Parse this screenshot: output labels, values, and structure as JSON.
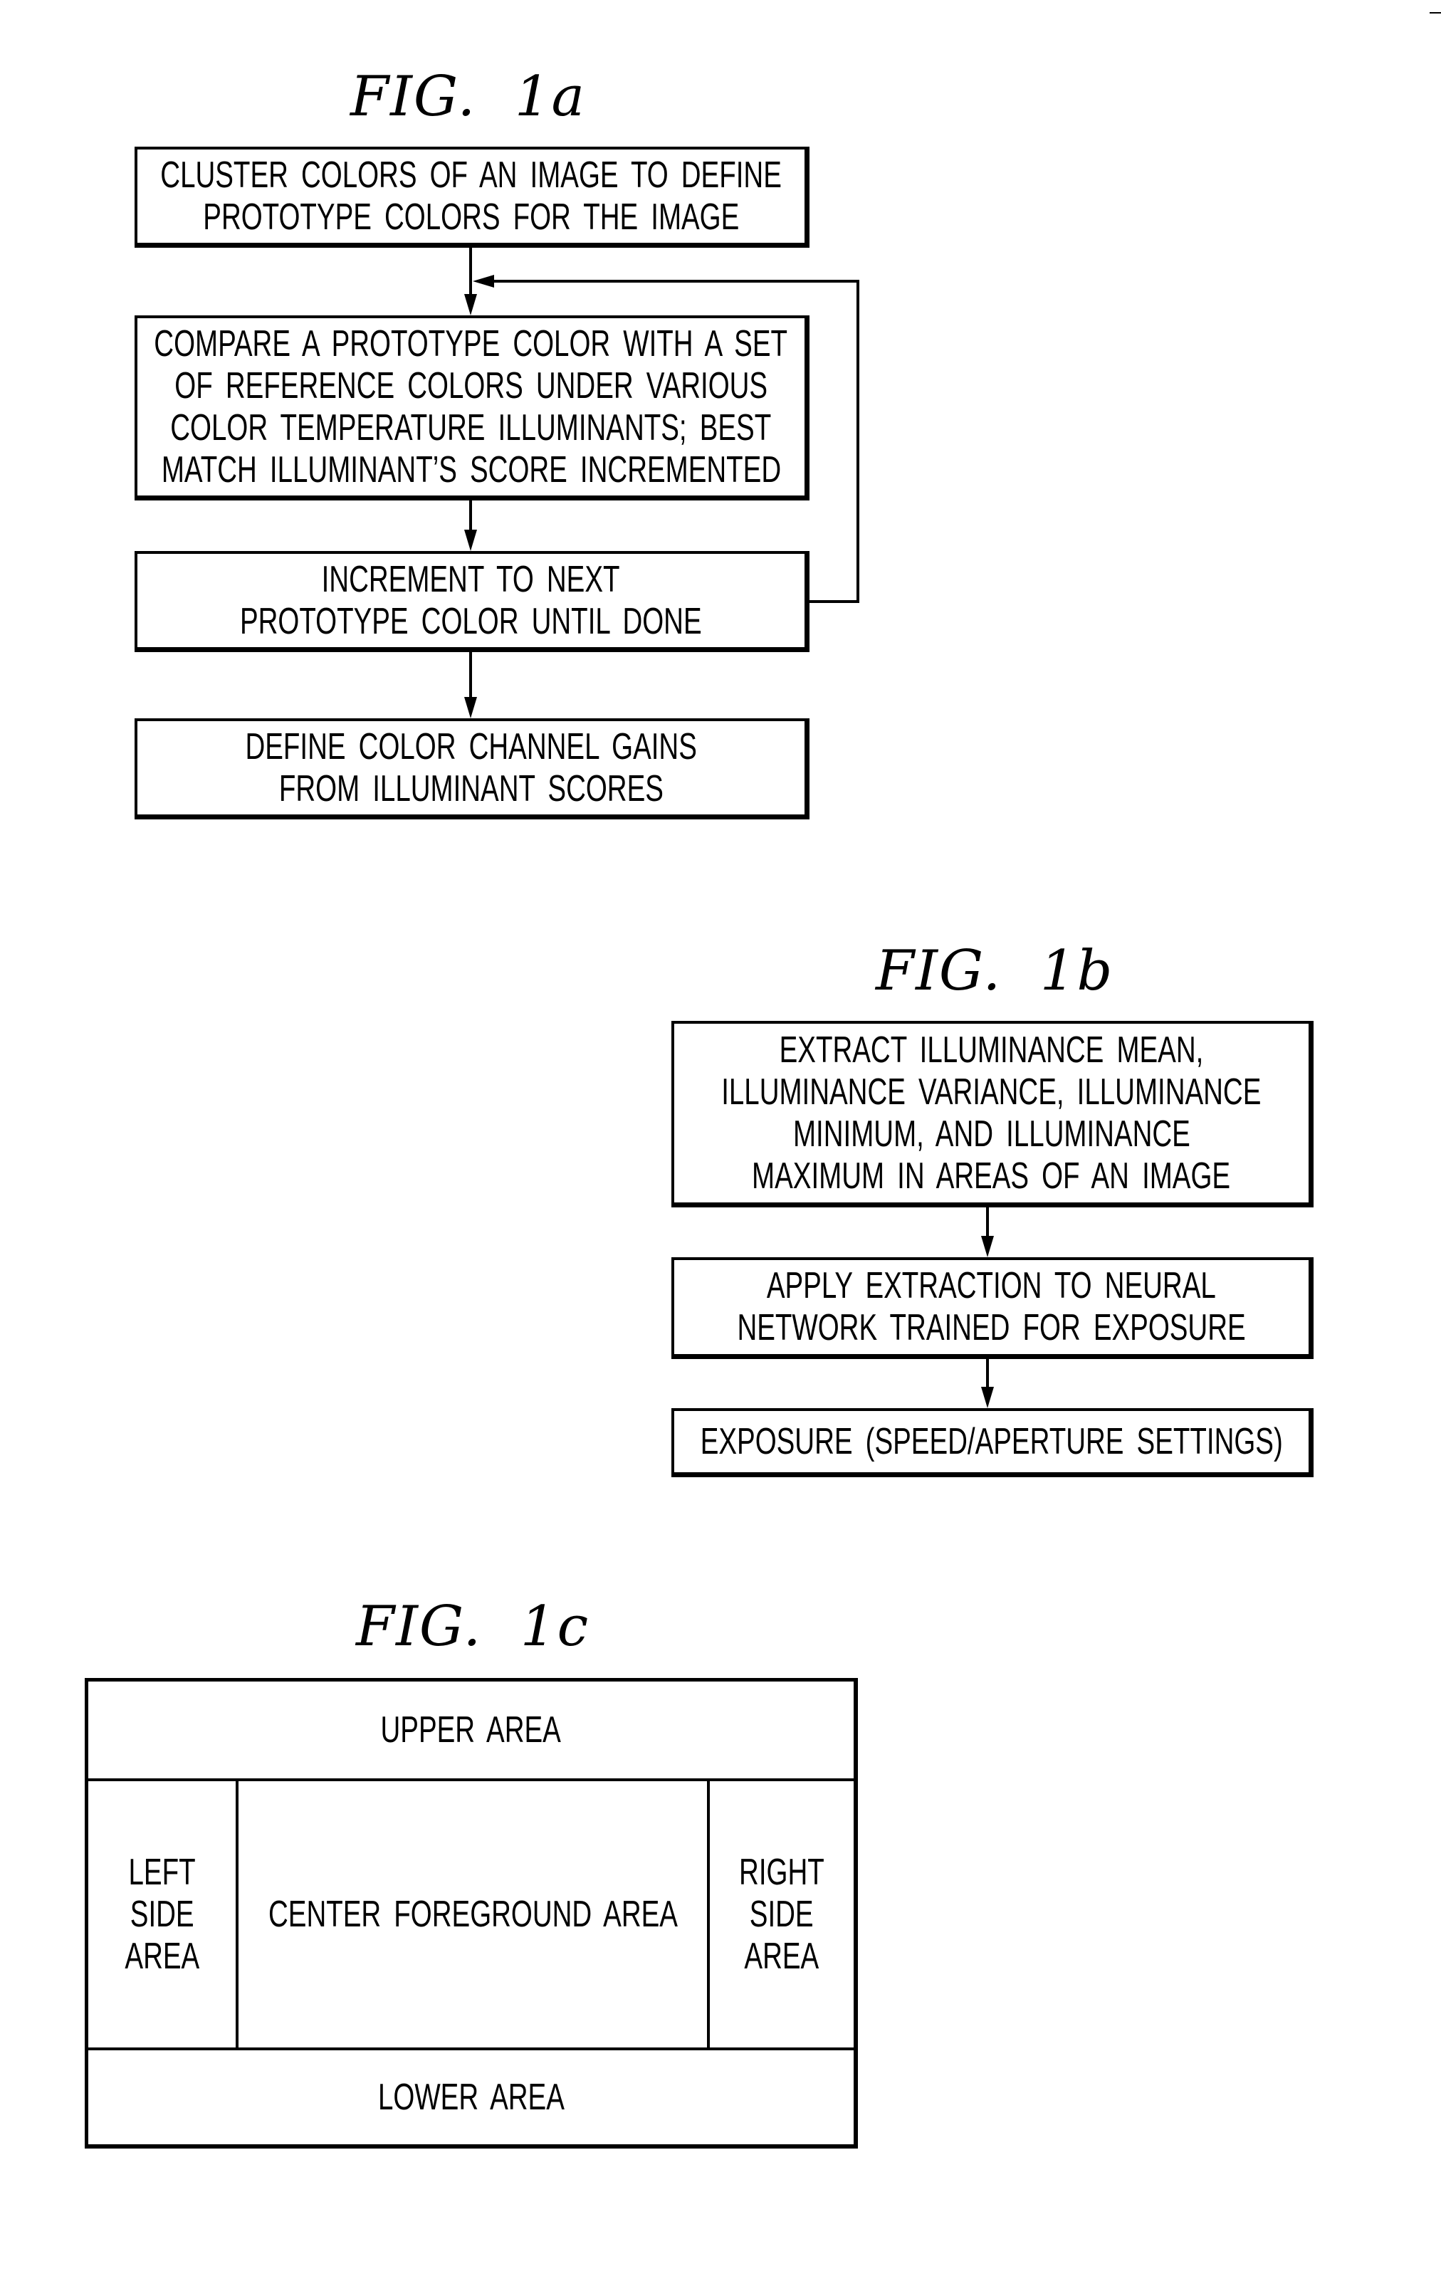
{
  "figures": {
    "fig1a": {
      "title": "FIG.  1a",
      "steps": [
        {
          "lines": [
            "CLUSTER COLORS OF AN IMAGE TO DEFINE",
            "PROTOTYPE COLORS FOR THE IMAGE"
          ]
        },
        {
          "lines": [
            "COMPARE A PROTOTYPE COLOR WITH A SET",
            "OF REFERENCE COLORS UNDER VARIOUS",
            "COLOR TEMPERATURE ILLUMINANTS; BEST",
            "MATCH ILLUMINANT’S SCORE INCREMENTED"
          ]
        },
        {
          "lines": [
            "INCREMENT TO NEXT",
            "PROTOTYPE COLOR UNTIL DONE"
          ]
        },
        {
          "lines": [
            "DEFINE COLOR CHANNEL GAINS",
            "FROM ILLUMINANT SCORES"
          ]
        }
      ],
      "loop": {
        "from_step": 3,
        "to_step": 2
      }
    },
    "fig1b": {
      "title": "FIG.  1b",
      "steps": [
        {
          "lines": [
            "EXTRACT ILLUMINANCE MEAN,",
            "ILLUMINANCE VARIANCE, ILLUMINANCE",
            "MINIMUM, AND ILLUMINANCE",
            "MAXIMUM IN AREAS OF AN IMAGE"
          ]
        },
        {
          "lines": [
            "APPLY EXTRACTION TO NEURAL",
            "NETWORK TRAINED FOR EXPOSURE"
          ]
        },
        {
          "lines": [
            "EXPOSURE (SPEED/APERTURE SETTINGS)"
          ]
        }
      ]
    },
    "fig1c": {
      "title": "FIG.  1c",
      "regions": {
        "upper": [
          "UPPER AREA"
        ],
        "left": [
          "LEFT",
          "SIDE",
          "AREA"
        ],
        "center": [
          "CENTER FOREGROUND AREA"
        ],
        "right": [
          "RIGHT",
          "SIDE",
          "AREA"
        ],
        "lower": [
          "LOWER AREA"
        ]
      }
    }
  }
}
